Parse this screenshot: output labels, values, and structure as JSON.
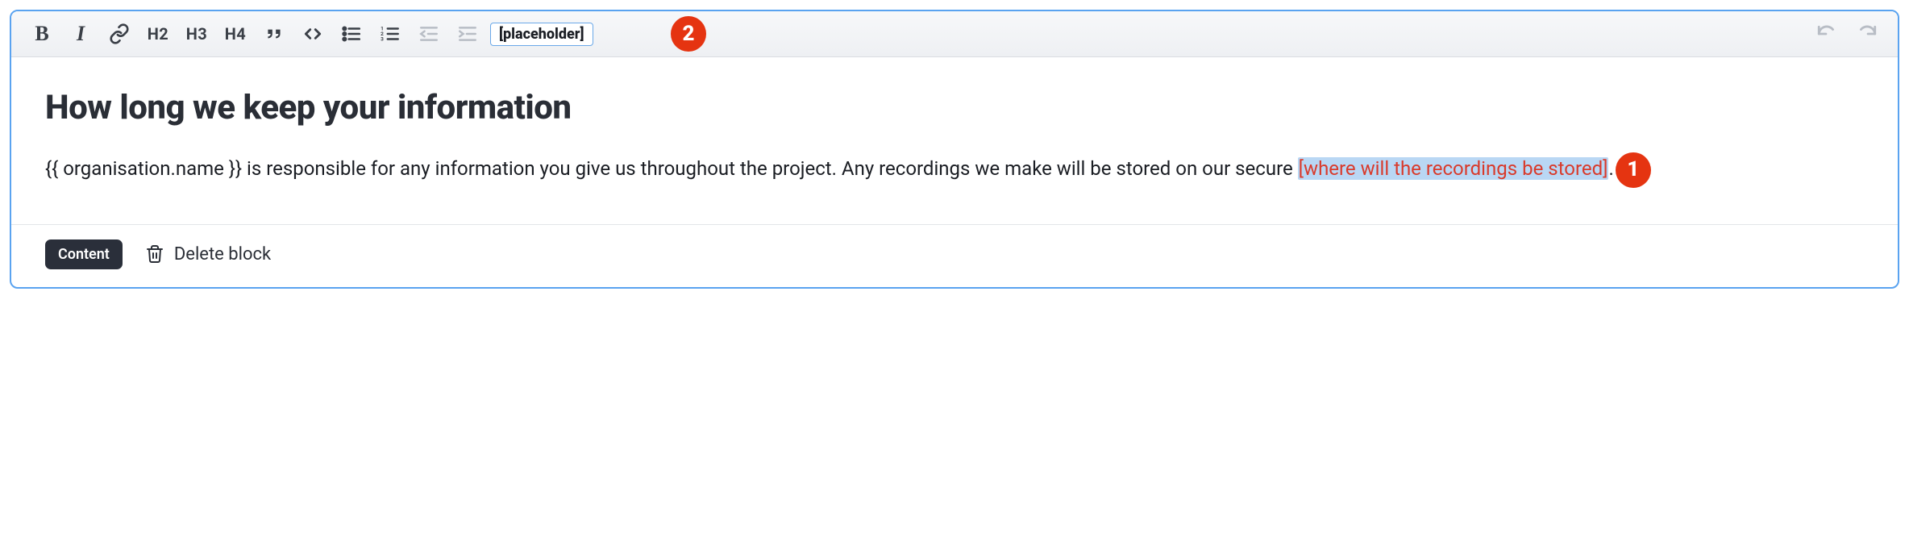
{
  "toolbar": {
    "bold": "B",
    "italic": "I",
    "h2": "H2",
    "h3": "H3",
    "h4": "H4",
    "placeholder_button": "[placeholder]"
  },
  "annotations": {
    "badge1": "1",
    "badge2": "2"
  },
  "content": {
    "heading": "How long we keep your information",
    "para_pre": "{{ organisation.name }} is responsible for any information you give us throughout the project. Any recordings we make will be stored on our secure ",
    "placeholder_text": "[where will the recordings be stored]",
    "para_post": "."
  },
  "footer": {
    "content_button": "Content",
    "delete_label": "Delete block"
  }
}
